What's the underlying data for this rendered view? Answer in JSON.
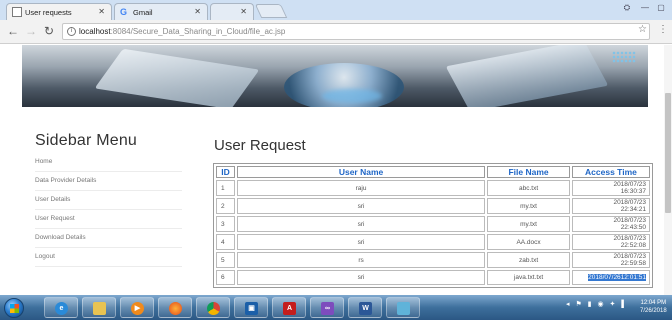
{
  "browser": {
    "tabs": [
      {
        "title": "User requests",
        "active": true
      },
      {
        "title": "Gmail",
        "active": false
      },
      {
        "title": "",
        "active": false
      }
    ],
    "url_host": "localhost",
    "url_rest": ":8084/Secure_Data_Sharing_in_Cloud/file_ac.jsp"
  },
  "sidebar": {
    "title": "Sidebar Menu",
    "items": [
      {
        "label": "Home"
      },
      {
        "label": "Data Provider Details"
      },
      {
        "label": "User Details"
      },
      {
        "label": "User Request"
      },
      {
        "label": "Download Details"
      },
      {
        "label": "Logout"
      }
    ]
  },
  "main": {
    "title": "User Request",
    "columns": [
      "ID",
      "User Name",
      "File Name",
      "Access Time"
    ],
    "rows": [
      {
        "id": "1",
        "user": "raju",
        "file": "abc.txt",
        "date": "2018/07/23",
        "time": "16:30:37"
      },
      {
        "id": "2",
        "user": "sri",
        "file": "my.txt",
        "date": "2018/07/23",
        "time": "22:34:21"
      },
      {
        "id": "3",
        "user": "sri",
        "file": "my.txt",
        "date": "2018/07/23",
        "time": "22:43:50"
      },
      {
        "id": "4",
        "user": "sri",
        "file": "AA.docx",
        "date": "2018/07/23",
        "time": "22:52:08"
      },
      {
        "id": "5",
        "user": "rs",
        "file": "zab.txt",
        "date": "2018/07/23",
        "time": "22:59:58"
      },
      {
        "id": "6",
        "user": "sri",
        "file": "java.txt.txt",
        "date": "2018/07/26",
        "time": "12:01:51"
      }
    ]
  },
  "taskbar": {
    "clock_time": "12:04 PM",
    "clock_date": "7/26/2018"
  },
  "colors": {
    "header_text": "#1f66c6",
    "selection": "#3478d1",
    "taskbar": "#3d6f9c"
  }
}
